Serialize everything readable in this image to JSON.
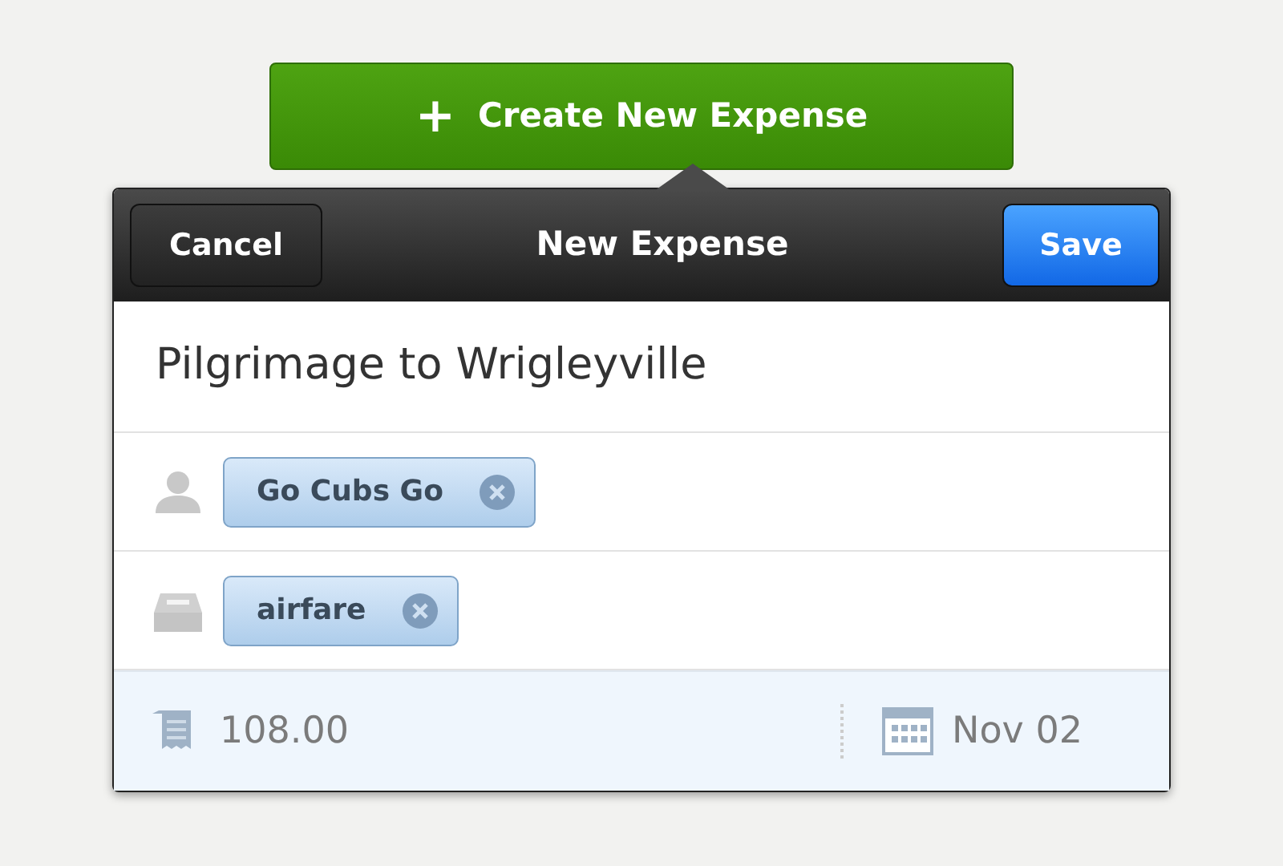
{
  "create_button": {
    "icon": "+",
    "label": "Create New Expense"
  },
  "header": {
    "cancel": "Cancel",
    "title": "New Expense",
    "save": "Save"
  },
  "expense_title": "Pilgrimage to Wrigleyville",
  "tag_rows": [
    {
      "kind": "person",
      "tags": [
        {
          "label": "Go Cubs Go"
        }
      ]
    },
    {
      "kind": "category",
      "tags": [
        {
          "label": "airfare"
        }
      ]
    }
  ],
  "footer": {
    "amount": "108.00",
    "date": "Nov 02"
  }
}
